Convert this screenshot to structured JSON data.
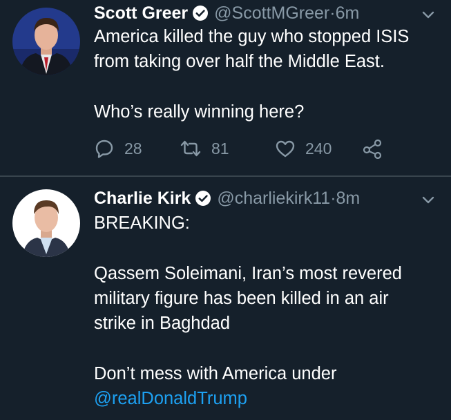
{
  "tweets": [
    {
      "display_name": "Scott Greer",
      "handle": "@ScottMGreer",
      "time": "6m",
      "lines": [
        "America killed the guy who stopped ISIS",
        "from taking over half the Middle East.",
        "",
        "Who’s really winning here?"
      ],
      "replies": "28",
      "retweets": "81",
      "likes": "240"
    },
    {
      "display_name": "Charlie Kirk",
      "handle": "@charliekirk11",
      "time": "8m",
      "lines": [
        "BREAKING:",
        "",
        "Qassem Soleimani, Iran’s most revered",
        "military figure has been killed in an air",
        "strike in Baghdad",
        "",
        "Don’t mess with America under"
      ],
      "mention": "@realDonaldTrump"
    }
  ],
  "separator": " · ",
  "colors": {
    "background": "#15202b",
    "text": "#ffffff",
    "secondary": "#8899a6",
    "link": "#1da1f2",
    "divider": "#38444d"
  },
  "icons": [
    "verified-badge-icon",
    "chevron-down-icon",
    "reply-icon",
    "retweet-icon",
    "like-icon",
    "share-icon"
  ]
}
